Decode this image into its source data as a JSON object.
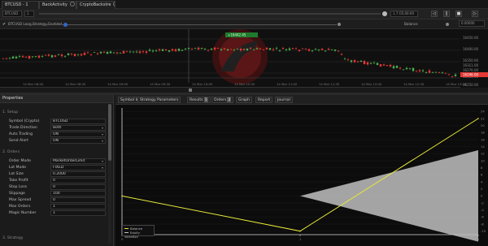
{
  "tabs": [
    "BTCUSD - 1",
    "BackActivity",
    "CryptoBackstre"
  ],
  "toolbar": {
    "symbol": "BTCUSD",
    "timeframe": "1",
    "zoom_value": "1.7 CR,00:00"
  },
  "options": {
    "checkbox_label": "BTCUSD Long Strategy Enabled",
    "right_label": "Balance",
    "right_value": "0.00000"
  },
  "price_chart": {
    "price_labels": [
      "16450.00",
      "16400.00",
      "16350.00",
      "16300.00",
      "16250.00"
    ],
    "time_labels": [
      "14 Mar 08:00",
      "14 Mar 08:30",
      "14 Mar 09:00",
      "14 Mar 09:30",
      "14 Mar 10:00",
      "14 Mar 10:30",
      "14 Mar 11:00",
      "14 Mar 11:30",
      "14 Mar 12:00",
      "14 Mar 12:30",
      "14 Mar 13:00"
    ],
    "marker_label": "+16442.45",
    "current_price_label": "16246.00",
    "price_tags": [
      "16311.00",
      "16276.00"
    ],
    "bull_color": "#4caf50",
    "bear_color": "#e53935"
  },
  "panel": {
    "title": "Properties",
    "sections": [
      "1. Setup",
      "2. Orders",
      "3. Strategy"
    ],
    "rows": [
      {
        "label": "Symbol (Crypto)",
        "value": "BTCUSD",
        "dropdown": false
      },
      {
        "label": "Trade Direction",
        "value": "Both",
        "dropdown": true
      },
      {
        "label": "Auto Trading",
        "value": "ON",
        "dropdown": true
      },
      {
        "label": "Send Alert",
        "value": "ON",
        "dropdown": true
      },
      {
        "label": "Order Mode",
        "value": "MarketOrderLimit",
        "dropdown": true
      },
      {
        "label": "Lot Mode",
        "value": "FIXED",
        "dropdown": true
      },
      {
        "label": "Lot Size",
        "value": "0.2000",
        "dropdown": false
      },
      {
        "label": "Take Profit",
        "value": "0",
        "dropdown": false
      },
      {
        "label": "Stop Loss",
        "value": "0",
        "dropdown": false
      },
      {
        "label": "Slippage",
        "value": "100",
        "dropdown": false
      },
      {
        "label": "Max Spread",
        "value": "0",
        "dropdown": false
      },
      {
        "label": "Max Orders",
        "value": "1",
        "dropdown": false
      },
      {
        "label": "Magic Number",
        "value": "1",
        "dropdown": false
      }
    ]
  },
  "result_tabs": [
    {
      "label": "Symbol Info",
      "badge": ""
    },
    {
      "label": "Strategy Parameters",
      "badge": ""
    },
    {
      "label": "Results",
      "badge": "1"
    },
    {
      "label": "Orders",
      "badge": "2"
    },
    {
      "label": "Graph",
      "badge": ""
    },
    {
      "label": "Report",
      "badge": ""
    },
    {
      "label": "Journal",
      "badge": ""
    }
  ],
  "chart_data": {
    "type": "area",
    "x": [
      0,
      1,
      2
    ],
    "x_tick_labels": [
      "0",
      "1",
      "2"
    ],
    "series": [
      {
        "name": "Balance",
        "values": [
          0,
          -10,
          22
        ],
        "color": "#e6e63c"
      },
      {
        "name": "Equity Variation",
        "band_upper": [
          0,
          0,
          13
        ],
        "band_lower": [
          0,
          0,
          -13
        ],
        "color": "#bfbfbf"
      }
    ],
    "xlim": [
      0,
      2
    ],
    "ylim": [
      -11,
      25
    ],
    "y_ticks": [
      24,
      22,
      20,
      18,
      16,
      14,
      12,
      10,
      8,
      6,
      4,
      2,
      0,
      -2,
      -4,
      -6,
      -8,
      -10
    ],
    "grid": true,
    "legend_position": "bottom-left"
  }
}
